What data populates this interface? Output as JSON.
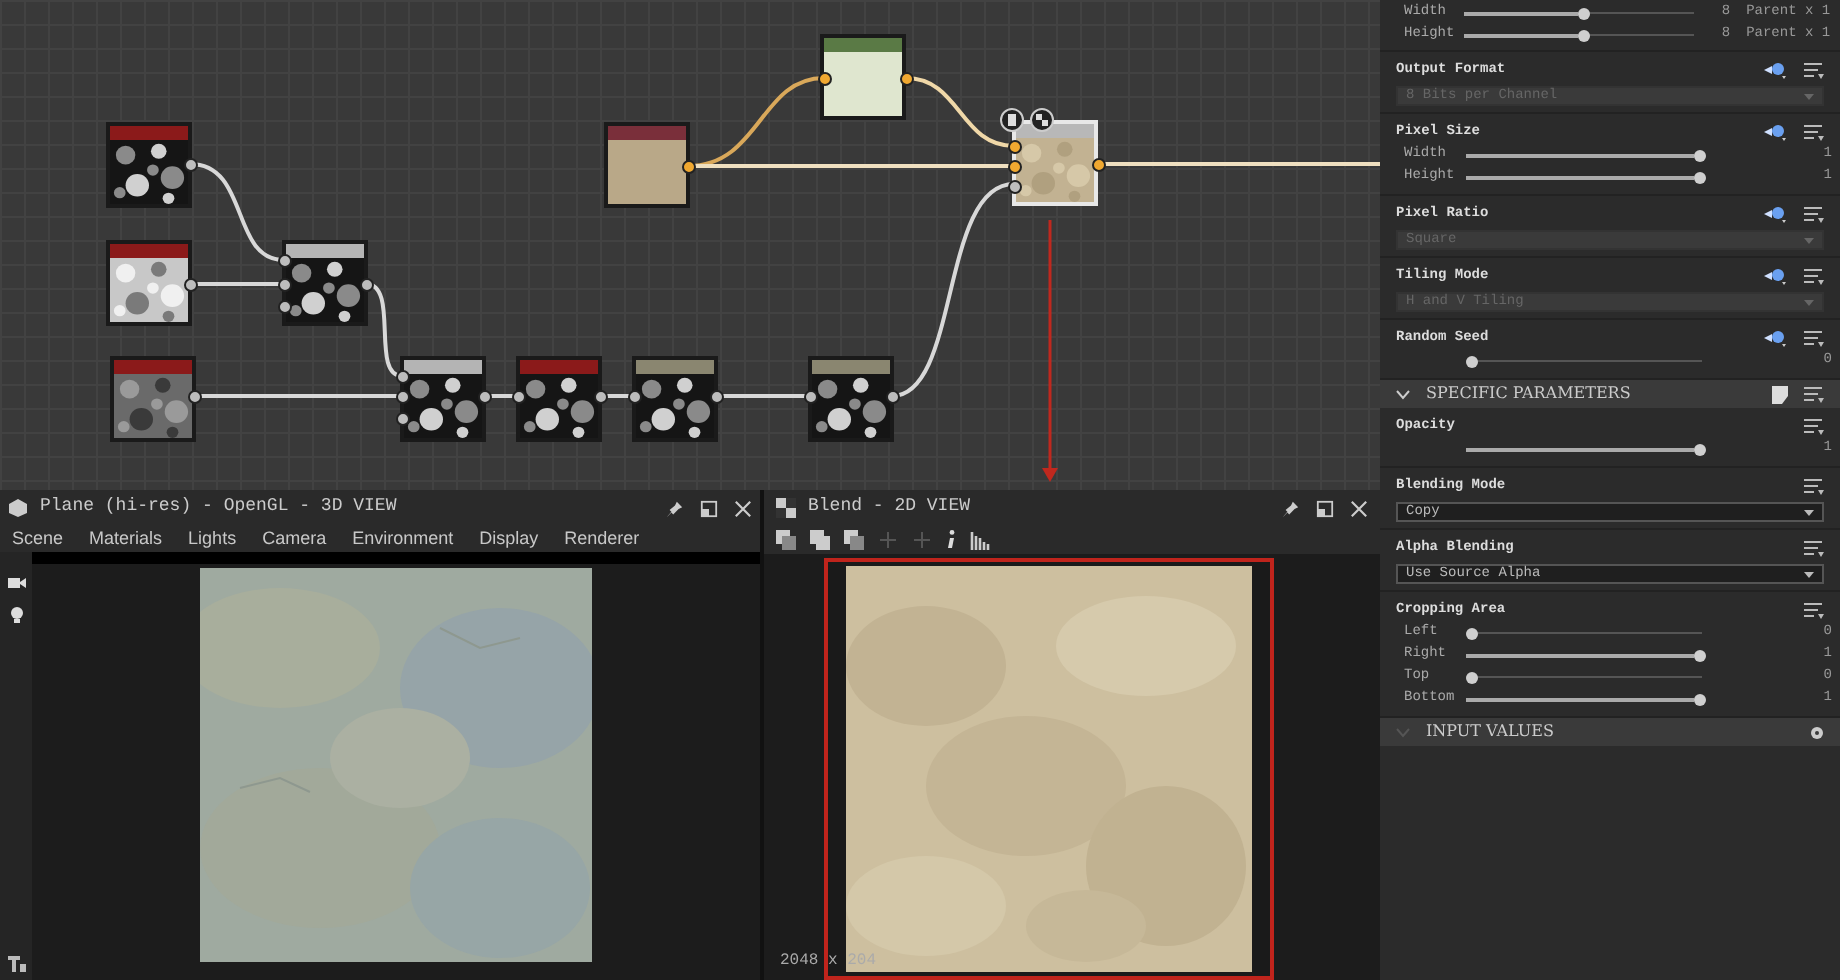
{
  "graph": {
    "nodes": [
      {
        "kind": "grunge",
        "color": "#8b1a1a",
        "selected": false
      },
      {
        "kind": "light",
        "color": "#8b1a1a",
        "selected": false
      },
      {
        "kind": "blur",
        "color": "#8b1a1a",
        "selected": false
      },
      {
        "kind": "grunge",
        "color": "#b4b4b4",
        "selected": false
      },
      {
        "kind": "grunge",
        "color": "#b4b4b4",
        "selected": false
      },
      {
        "kind": "grunge",
        "color": "#8b1a1a",
        "selected": false
      },
      {
        "kind": "grunge",
        "color": "#8a8670",
        "selected": false
      },
      {
        "kind": "grunge",
        "color": "#8a8670",
        "selected": false
      },
      {
        "kind": "tan",
        "color": "#7a2f3a",
        "selected": false
      },
      {
        "kind": "pale",
        "color": "#5a7a45",
        "selected": false
      },
      {
        "kind": "result",
        "color": "#b8b8b8",
        "selected": true
      }
    ]
  },
  "view_3d": {
    "title": "Plane (hi-res) - OpenGL - 3D VIEW",
    "menu": [
      "Scene",
      "Materials",
      "Lights",
      "Camera",
      "Environment",
      "Display",
      "Renderer"
    ]
  },
  "view_2d": {
    "title": "Blend - 2D VIEW",
    "status": "2048 x 204"
  },
  "base_params": [
    {
      "kind": "sliders",
      "rows": [
        {
          "label": "Width",
          "level": 0.5,
          "value": "8",
          "note": "Parent x 1"
        },
        {
          "label": "Height",
          "level": 0.5,
          "value": "8",
          "note": "Parent x 1"
        }
      ]
    },
    {
      "kind": "dropdown",
      "label": "Output Format",
      "value": "8 Bits per Channel",
      "disabled": true
    },
    {
      "kind": "sliders",
      "label": "Pixel Size",
      "rows": [
        {
          "label": "Width",
          "level": 1,
          "value": "1"
        },
        {
          "label": "Height",
          "level": 1,
          "value": "1"
        }
      ]
    },
    {
      "kind": "dropdown",
      "label": "Pixel Ratio",
      "value": "Square",
      "disabled": true
    },
    {
      "kind": "dropdown",
      "label": "Tiling Mode",
      "value": "H and V Tiling",
      "disabled": true
    },
    {
      "kind": "sliders",
      "label": "Random Seed",
      "rows": [
        {
          "level": 0,
          "value": "0"
        }
      ]
    }
  ],
  "sections": [
    {
      "title": "SPECIFIC PARAMETERS",
      "expanded": true,
      "params": [
        {
          "kind": "sliders",
          "label": "Opacity",
          "rows": [
            {
              "level": 1,
              "value": "1"
            }
          ]
        },
        {
          "kind": "dropdown",
          "label": "Blending Mode",
          "value": "Copy",
          "disabled": false
        },
        {
          "kind": "dropdown",
          "label": "Alpha Blending",
          "value": "Use Source Alpha",
          "disabled": false
        },
        {
          "kind": "sliders",
          "label": "Cropping Area",
          "rows": [
            {
              "label": "Left",
              "level": 0,
              "value": "0"
            },
            {
              "label": "Right",
              "level": 1,
              "value": "1"
            },
            {
              "label": "Top",
              "level": 0,
              "value": "0"
            },
            {
              "label": "Bottom",
              "level": 1,
              "value": "1"
            }
          ]
        }
      ]
    },
    {
      "title": "INPUT VALUES",
      "expanded": false
    }
  ]
}
